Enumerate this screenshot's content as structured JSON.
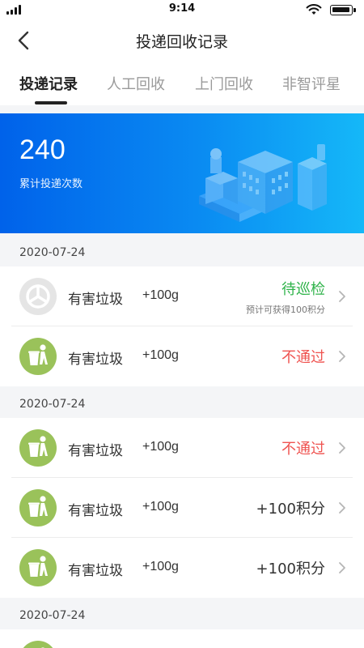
{
  "statusbar": {
    "time": "9:14"
  },
  "header": {
    "title": "投递回收记录"
  },
  "tabs": [
    {
      "label": "投递记录",
      "active": true
    },
    {
      "label": "人工回收",
      "active": false
    },
    {
      "label": "上门回收",
      "active": false
    },
    {
      "label": "非智评星",
      "active": false
    }
  ],
  "summary": {
    "count": "240",
    "label": "累计投递次数"
  },
  "groups": [
    {
      "date": "2020-07-24",
      "items": [
        {
          "name": "有害垃圾",
          "weight": "+100g",
          "status": "待巡检",
          "status_color": "#2fb34a",
          "sub": "预计可获得100积分",
          "icon": "gray-recycle-icon"
        },
        {
          "name": "有害垃圾",
          "weight": "+100g",
          "status": "不通过",
          "status_color": "#ef5350",
          "icon": "trash-person-icon"
        }
      ]
    },
    {
      "date": "2020-07-24",
      "items": [
        {
          "name": "有害垃圾",
          "weight": "+100g",
          "status": "不通过",
          "status_color": "#ef5350",
          "icon": "trash-person-icon"
        },
        {
          "name": "有害垃圾",
          "weight": "+100g",
          "status": "+100积分",
          "status_color": "#333333",
          "icon": "trash-person-icon"
        },
        {
          "name": "有害垃圾",
          "weight": "+100g",
          "status": "+100积分",
          "status_color": "#333333",
          "icon": "trash-person-icon"
        }
      ]
    },
    {
      "date": "2020-07-24",
      "items": [
        {
          "icon": "trash-person-icon"
        }
      ]
    }
  ]
}
